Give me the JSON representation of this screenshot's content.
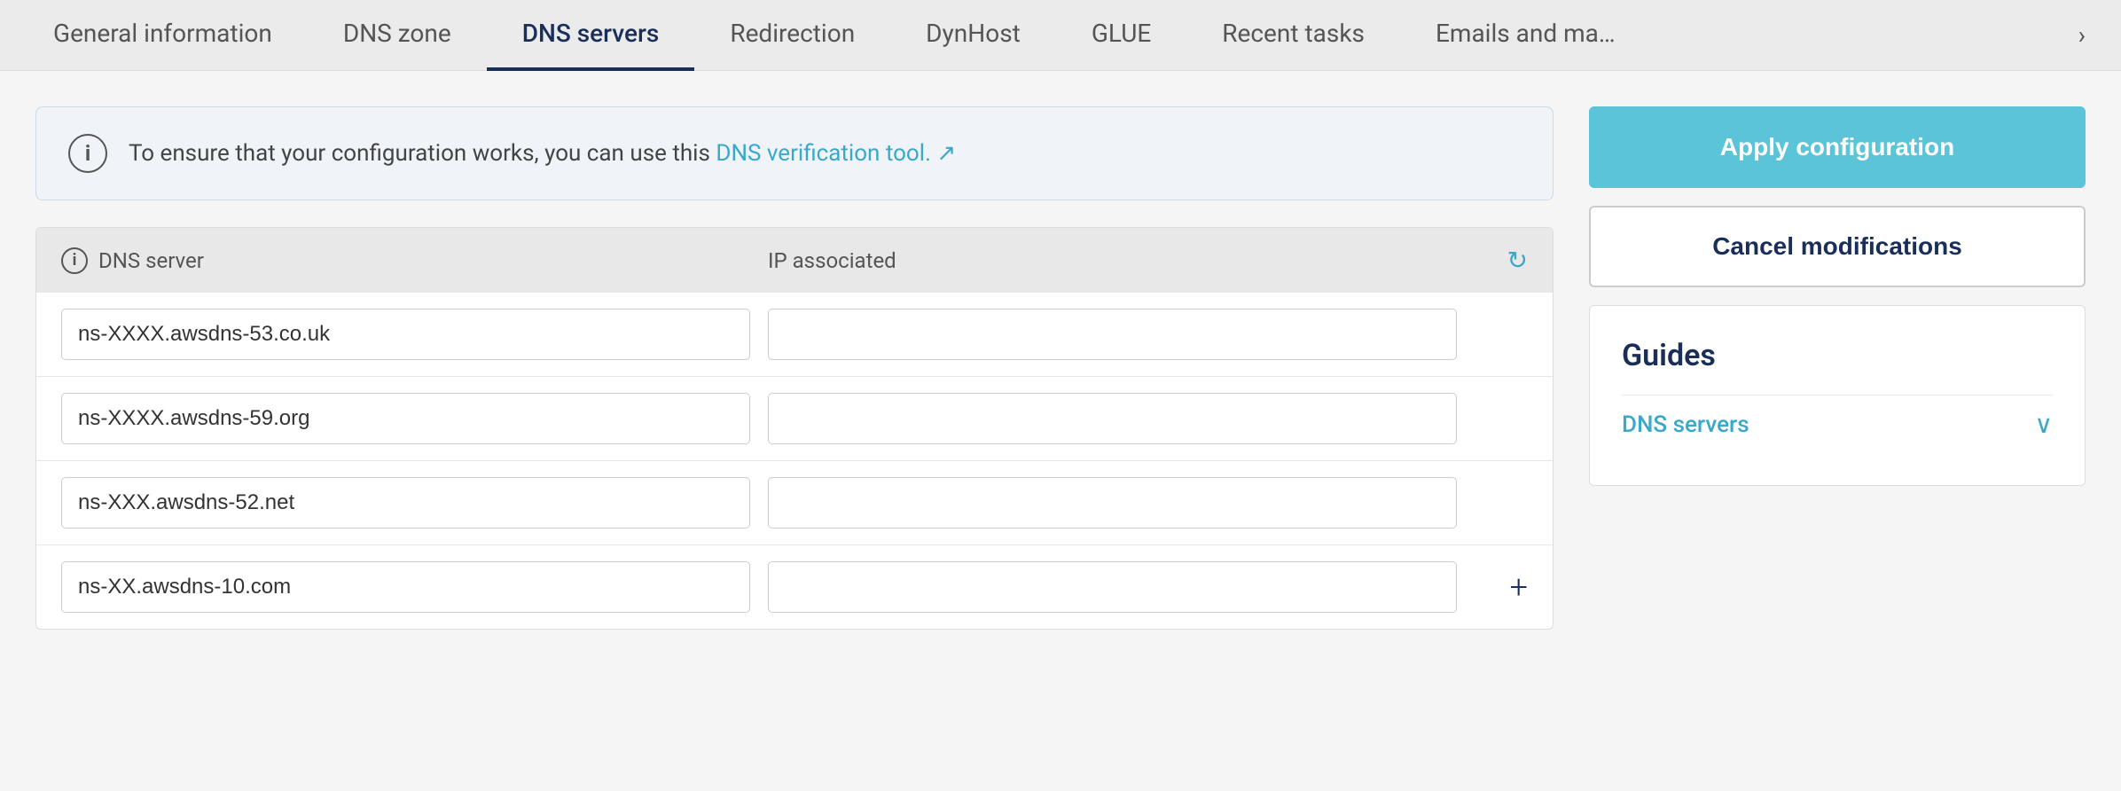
{
  "tabs": [
    {
      "id": "general-information",
      "label": "General information",
      "active": false
    },
    {
      "id": "dns-zone",
      "label": "DNS zone",
      "active": false
    },
    {
      "id": "dns-servers",
      "label": "DNS servers",
      "active": true
    },
    {
      "id": "redirection",
      "label": "Redirection",
      "active": false
    },
    {
      "id": "dynhost",
      "label": "DynHost",
      "active": false
    },
    {
      "id": "glue",
      "label": "GLUE",
      "active": false
    },
    {
      "id": "recent-tasks",
      "label": "Recent tasks",
      "active": false
    },
    {
      "id": "emails-and-ma",
      "label": "Emails and ma…",
      "active": false
    }
  ],
  "info_banner": {
    "text_before_link": "To ensure that your configuration works, you can use this ",
    "link_text": "DNS verification tool.",
    "link_icon": "↗"
  },
  "table": {
    "col1_label": "DNS server",
    "col2_label": "IP associated",
    "rows": [
      {
        "dns_server": "ns-XXXX.awsdns-53.co.uk",
        "ip_associated": ""
      },
      {
        "dns_server": "ns-XXXX.awsdns-59.org",
        "ip_associated": ""
      },
      {
        "dns_server": "ns-XXX.awsdns-52.net",
        "ip_associated": ""
      },
      {
        "dns_server": "ns-XX.awsdns-10.com",
        "ip_associated": ""
      }
    ]
  },
  "buttons": {
    "apply_label": "Apply configuration",
    "cancel_label": "Cancel modifications"
  },
  "guides": {
    "title": "Guides",
    "items": [
      {
        "label": "DNS servers"
      }
    ]
  },
  "icons": {
    "info": "i",
    "refresh": "↻",
    "add": "+",
    "chevron_right": "›",
    "chevron_down": "∨",
    "external_link": "↗"
  }
}
